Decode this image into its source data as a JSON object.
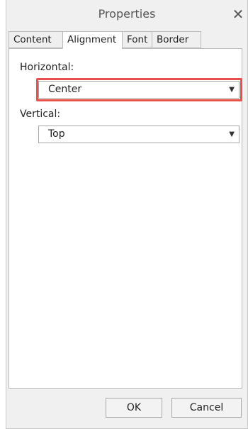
{
  "dialog": {
    "title": "Properties",
    "close_icon": "close-icon",
    "close_glyph": "✕"
  },
  "tabs": [
    {
      "label": "Content",
      "active": false
    },
    {
      "label": "Alignment",
      "active": true
    },
    {
      "label": "Font",
      "active": false
    },
    {
      "label": "Border",
      "active": false
    }
  ],
  "alignment": {
    "horizontal": {
      "label": "Horizontal:",
      "value": "Center",
      "highlighted": true
    },
    "vertical": {
      "label": "Vertical:",
      "value": "Top"
    },
    "dropdown_glyph": "▼"
  },
  "buttons": {
    "ok": "OK",
    "cancel": "Cancel"
  },
  "colors": {
    "highlight": "#e9504b",
    "window_bg": "#f0f0f0",
    "panel_bg": "#ffffff"
  }
}
